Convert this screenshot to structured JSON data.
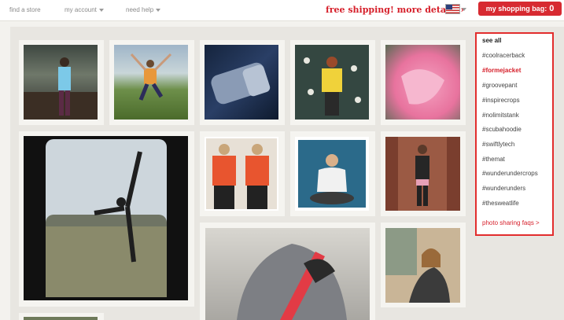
{
  "topbar": {
    "find_store": "find a store",
    "my_account": "my account",
    "need_help": "need help",
    "promo": "free shipping! more details",
    "promo_arrow": "›",
    "country_flag": "us-flag-icon",
    "bag_label": "my shopping bag:",
    "bag_count": "0"
  },
  "sidebar": {
    "see_all": "see all",
    "tags": [
      "#coolracerback",
      "#formejacket",
      "#groovepant",
      "#inspirecrops",
      "#nolimitstank",
      "#scubahoodie",
      "#swiftlytech",
      "#themat",
      "#wunderundercrops",
      "#wunderunders",
      "#thesweatlife"
    ],
    "active_tag": "#formejacket",
    "faq": "photo sharing faqs >"
  },
  "colors": {
    "accent": "#d6202b",
    "highlight_border": "#e22d2d"
  }
}
